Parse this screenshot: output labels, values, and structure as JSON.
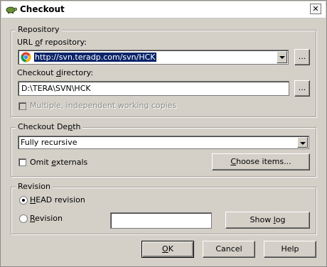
{
  "window": {
    "title": "Checkout",
    "close_glyph": "✕"
  },
  "repository": {
    "legend": "Repository",
    "url_label_pre": "URL ",
    "url_label_key": "o",
    "url_label_post": "f repository:",
    "url_value": "http://svn.teradp.com/svn/HCK",
    "dir_label_pre": "Checkout ",
    "dir_label_key": "d",
    "dir_label_post": "irectory:",
    "dir_value": "D:\\TERA\\SVN\\HCK",
    "browse_label": "...",
    "multiple_label": "Multiple, independent working copies"
  },
  "depth": {
    "legend_pre": "Checkout De",
    "legend_key": "p",
    "legend_post": "th",
    "selected": "Fully recursive",
    "omit_pre": "Omit ",
    "omit_key": "e",
    "omit_post": "xternals",
    "choose_pre": "",
    "choose_key": "C",
    "choose_post": "hoose items..."
  },
  "revision": {
    "legend": "Revision",
    "head_pre": "",
    "head_key": "H",
    "head_post": "EAD revision",
    "rev_pre": "",
    "rev_key": "R",
    "rev_post": "evision",
    "rev_value": "",
    "showlog_pre": "Show ",
    "showlog_key": "l",
    "showlog_post": "og"
  },
  "buttons": {
    "ok_key": "O",
    "ok_post": "K",
    "cancel": "Cancel",
    "help": "Help"
  },
  "icons": {
    "app": "tortoise-icon",
    "browser": "chrome-icon"
  }
}
